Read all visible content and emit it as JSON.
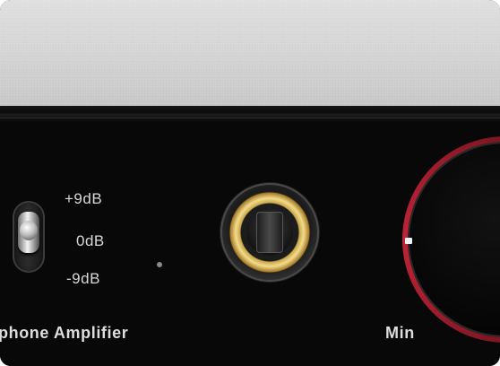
{
  "panel": {
    "gain_labels": [
      "+9dB",
      "0dB",
      "-9dB"
    ],
    "section_label": "phone Amplifier",
    "volume_label": "Min"
  },
  "colors": {
    "brushed_top": "#d2d2d2",
    "front_panel": "#080808",
    "knob_ring_accent": "#e0324a",
    "jack_gold": "#d8b45a"
  }
}
